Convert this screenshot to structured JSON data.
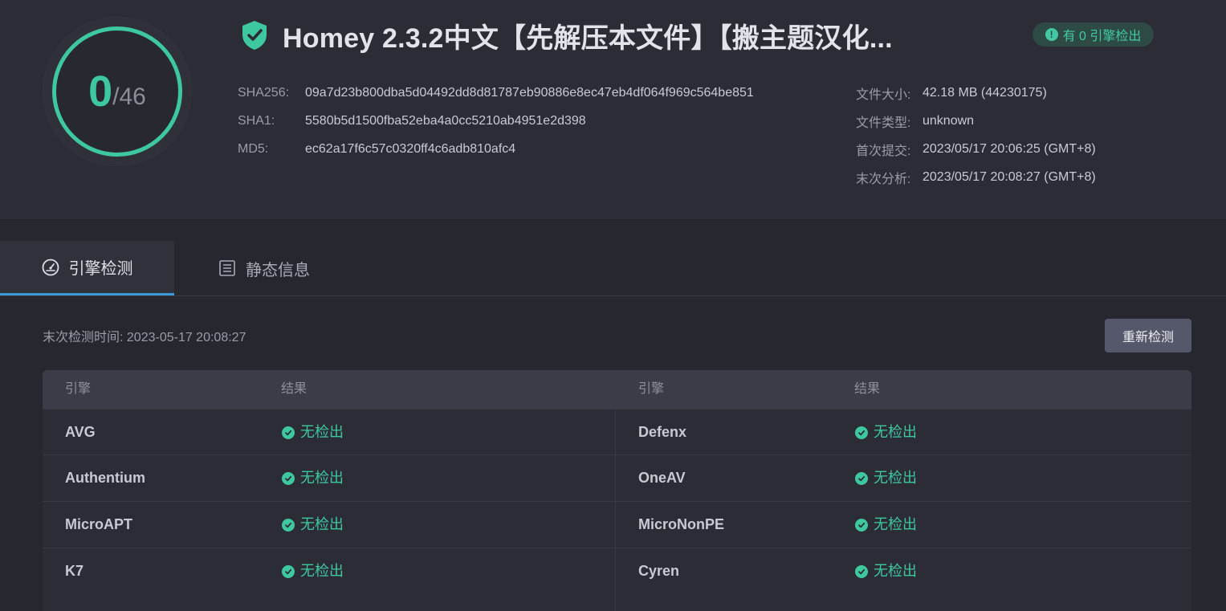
{
  "score": {
    "detected": "0",
    "total": "/46"
  },
  "file": {
    "title": "Homey 2.3.2中文【先解压本文件】【搬主题汉化...",
    "badge": "有 0 引擎检出",
    "hashes": [
      {
        "key": "SHA256:",
        "value": "09a7d23b800dba5d04492dd8d81787eb90886e8ec47eb4df064f969c564be851"
      },
      {
        "key": "SHA1:",
        "value": "5580b5d1500fba52eba4a0cc5210ab4951e2d398"
      },
      {
        "key": "MD5:",
        "value": "ec62a17f6c57c0320ff4c6adb810afc4"
      }
    ],
    "meta": [
      {
        "key": "文件大小:",
        "value": "42.18 MB (44230175)"
      },
      {
        "key": "文件类型:",
        "value": "unknown"
      },
      {
        "key": "首次提交:",
        "value": "2023/05/17 20:06:25 (GMT+8)"
      },
      {
        "key": "末次分析:",
        "value": "2023/05/17 20:08:27 (GMT+8)"
      }
    ]
  },
  "tabs": {
    "engine_detection": "引擎检测",
    "static_info": "静态信息"
  },
  "scan": {
    "last_check": "末次检测时间: 2023-05-17 20:08:27",
    "rescan_button": "重新检测"
  },
  "engines": {
    "headers": {
      "engine": "引擎",
      "result": "结果"
    },
    "rows": [
      {
        "left_name": "AVG",
        "left_result": "无检出",
        "right_name": "Defenx",
        "right_result": "无检出"
      },
      {
        "left_name": "Authentium",
        "left_result": "无检出",
        "right_name": "OneAV",
        "right_result": "无检出"
      },
      {
        "left_name": "MicroAPT",
        "left_result": "无检出",
        "right_name": "MicroNonPE",
        "right_result": "无检出"
      },
      {
        "left_name": "K7",
        "left_result": "无检出",
        "right_name": "Cyren",
        "right_result": "无检出"
      }
    ]
  },
  "colors": {
    "accent": "#3ec8a0",
    "tab_underline": "#3b98d6",
    "background": "#26272f"
  }
}
